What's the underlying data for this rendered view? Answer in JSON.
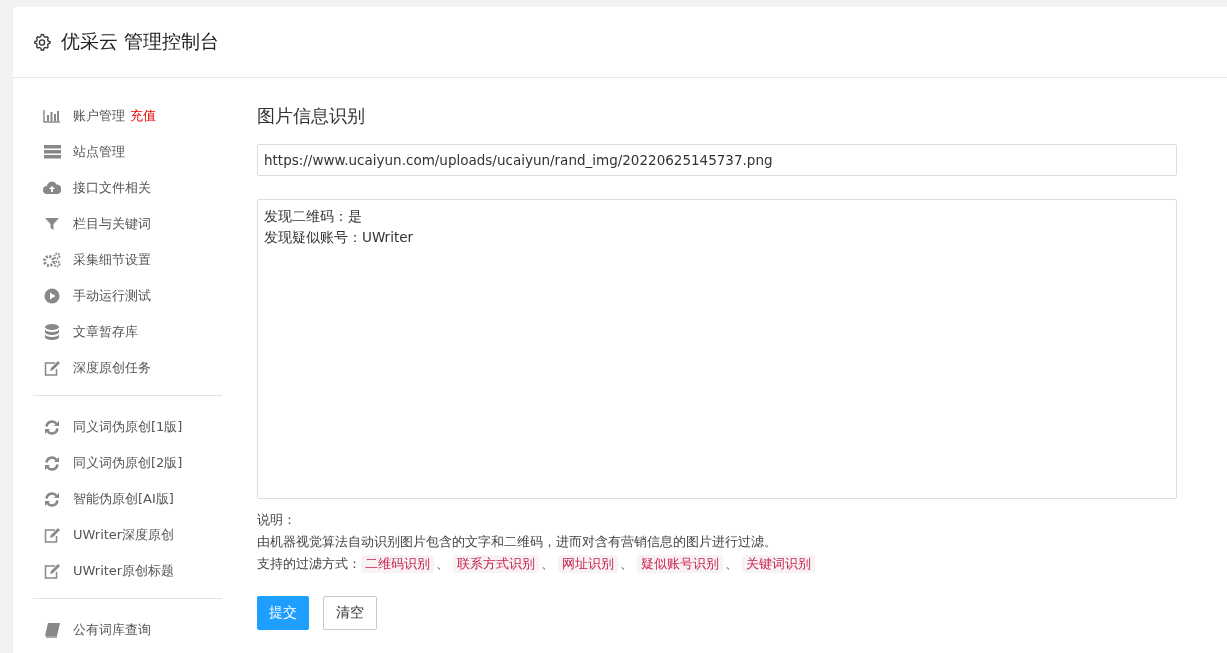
{
  "header": {
    "title": "优采云 管理控制台"
  },
  "sidebar": {
    "groups": [
      {
        "items": [
          {
            "label": "账户管理",
            "badge": "充值"
          },
          {
            "label": "站点管理"
          },
          {
            "label": "接口文件相关"
          },
          {
            "label": "栏目与关键词"
          },
          {
            "label": "采集细节设置"
          },
          {
            "label": "手动运行测试"
          },
          {
            "label": "文章暂存库"
          },
          {
            "label": "深度原创任务"
          }
        ]
      },
      {
        "items": [
          {
            "label": "同义词伪原创[1版]"
          },
          {
            "label": "同义词伪原创[2版]"
          },
          {
            "label": "智能伪原创[AI版]"
          },
          {
            "label": "UWriter深度原创"
          },
          {
            "label": "UWriter原创标题"
          }
        ]
      },
      {
        "items": [
          {
            "label": "公有词库查询"
          }
        ]
      }
    ]
  },
  "main": {
    "title": "图片信息识别",
    "url_field": {
      "value": "https://www.ucaiyun.com/uploads/ucaiyun/rand_img/20220625145737.png"
    },
    "result_box": {
      "lines": [
        "发现二维码：是",
        "发现疑似账号：UWriter"
      ]
    },
    "note_label": "说明：",
    "note_text": "由机器视觉算法自动识别图片包含的文字和二维码，进而对含有营销信息的图片进行过滤。",
    "filter_label": "支持的过滤方式：",
    "filter_tags": [
      "二维码识别",
      "联系方式识别",
      "网址识别",
      "疑似账号识别",
      "关键词识别"
    ],
    "separator": "、",
    "buttons": [
      {
        "label": "提交",
        "kind": "primary"
      },
      {
        "label": "清空",
        "kind": "default"
      }
    ]
  }
}
